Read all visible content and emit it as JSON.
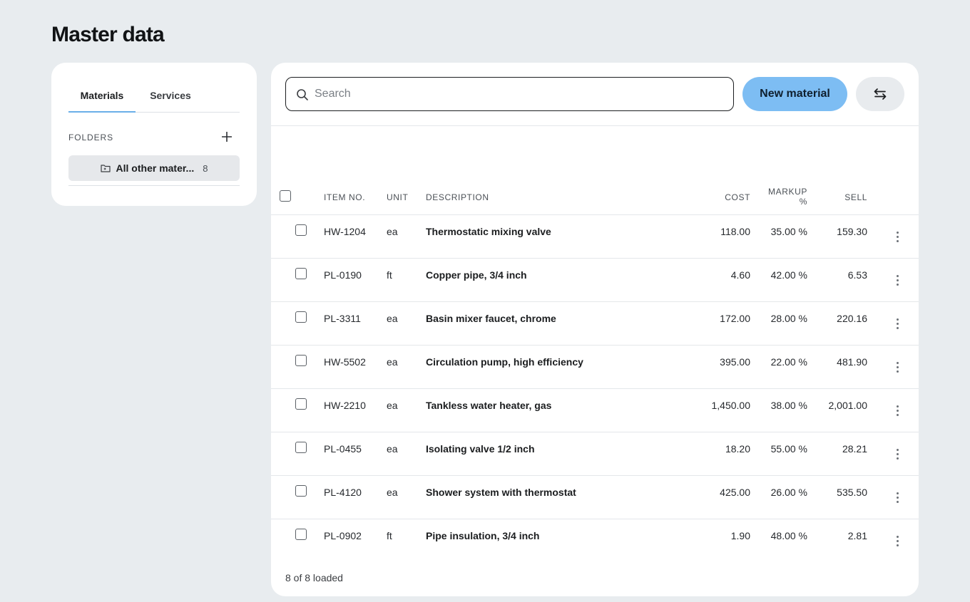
{
  "page": {
    "title": "Master data"
  },
  "sidebar": {
    "tabs": [
      {
        "label": "Materials",
        "active": true
      },
      {
        "label": "Services",
        "active": false
      }
    ],
    "folders_label": "FOLDERS",
    "folder": {
      "label": "All other mater...",
      "count": "8"
    }
  },
  "toolbar": {
    "search_placeholder": "Search",
    "search_value": "",
    "new_label": "New material"
  },
  "table": {
    "columns": {
      "item_no": "ITEM NO.",
      "unit": "UNIT",
      "description": "DESCRIPTION",
      "cost": "COST",
      "markup_1": "MARKUP",
      "markup_2": "%",
      "sell": "SELL"
    },
    "rows": [
      {
        "item_no": "HW-1204",
        "unit": "ea",
        "description": "Thermostatic mixing valve",
        "cost": "118.00",
        "markup": "35.00 %",
        "sell": "159.30"
      },
      {
        "item_no": "PL-0190",
        "unit": "ft",
        "description": "Copper pipe, 3/4 inch",
        "cost": "4.60",
        "markup": "42.00 %",
        "sell": "6.53"
      },
      {
        "item_no": "PL-3311",
        "unit": "ea",
        "description": "Basin mixer faucet, chrome",
        "cost": "172.00",
        "markup": "28.00 %",
        "sell": "220.16"
      },
      {
        "item_no": "HW-5502",
        "unit": "ea",
        "description": "Circulation pump, high efficiency",
        "cost": "395.00",
        "markup": "22.00 %",
        "sell": "481.90"
      },
      {
        "item_no": "HW-2210",
        "unit": "ea",
        "description": "Tankless water heater, gas",
        "cost": "1,450.00",
        "markup": "38.00 %",
        "sell": "2,001.00"
      },
      {
        "item_no": "PL-0455",
        "unit": "ea",
        "description": "Isolating valve 1/2 inch",
        "cost": "18.20",
        "markup": "55.00 %",
        "sell": "28.21"
      },
      {
        "item_no": "PL-4120",
        "unit": "ea",
        "description": "Shower system with thermostat",
        "cost": "425.00",
        "markup": "26.00 %",
        "sell": "535.50"
      },
      {
        "item_no": "PL-0902",
        "unit": "ft",
        "description": "Pipe insulation, 3/4 inch",
        "cost": "1.90",
        "markup": "48.00 %",
        "sell": "2.81"
      }
    ],
    "footer": "8 of 8 loaded"
  },
  "colors": {
    "background": "#e8ecef",
    "accent": "#7dbdf3",
    "tab_underline": "#6aafe8"
  }
}
